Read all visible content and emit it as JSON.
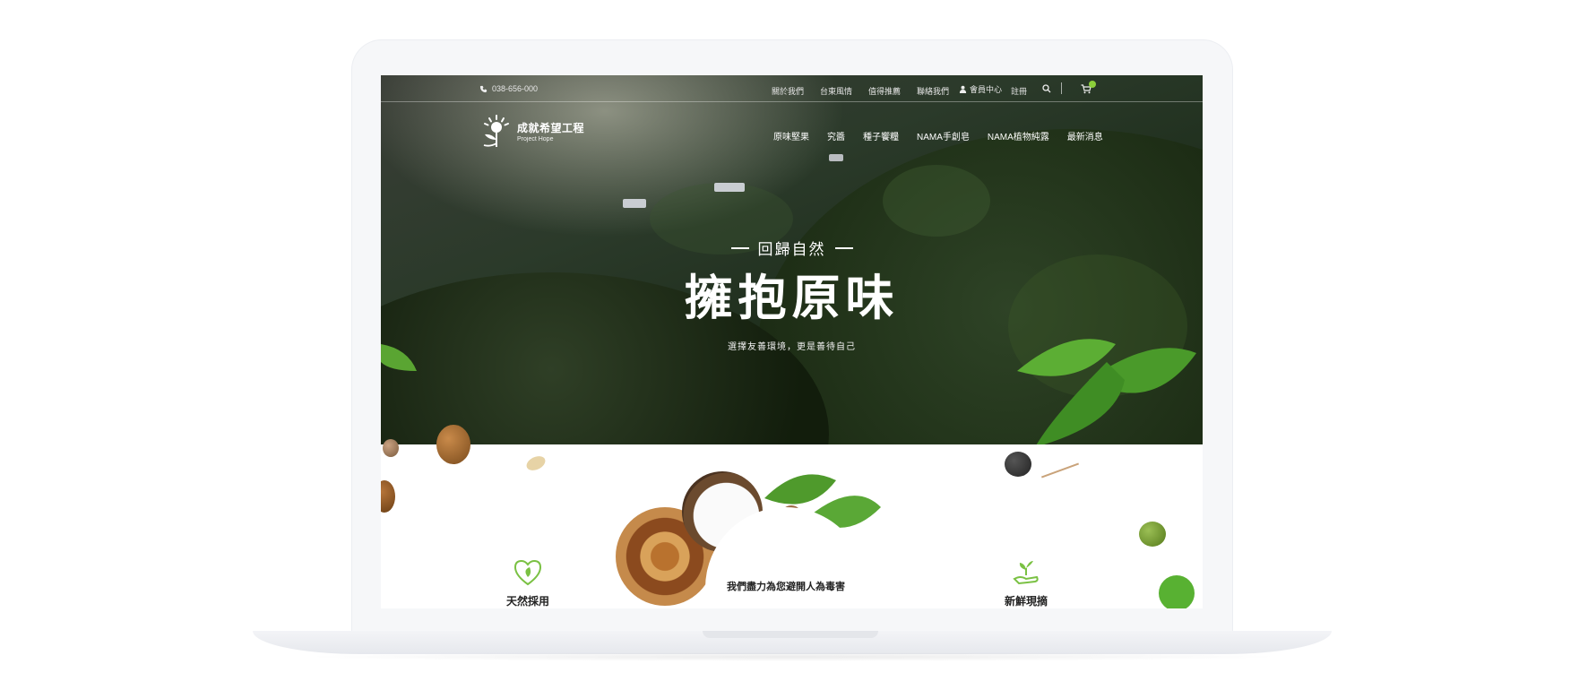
{
  "topbar": {
    "phone": "038-656-000",
    "links": [
      "關於我們",
      "台東風情",
      "值得推薦",
      "聯絡我們"
    ],
    "member_label": "會員中心",
    "register_label": "註冊"
  },
  "logo": {
    "name_cn": "成就希望工程",
    "name_en": "Project Hope"
  },
  "main_nav": [
    "原味堅果",
    "究醬",
    "種子饗糧",
    "NAMA手創皂",
    "NAMA植物純露",
    "最新消息"
  ],
  "hero": {
    "subtitle": "回歸自然",
    "title": "擁抱原味",
    "tagline": "選擇友善環境，更是善待自己"
  },
  "features": {
    "left_label": "天然採用",
    "center_label": "我們盡力為您避開人為毒害",
    "right_label": "新鮮現摘"
  },
  "colors": {
    "accent_green": "#7ac143",
    "hero_dark": "#1f2f1d"
  }
}
